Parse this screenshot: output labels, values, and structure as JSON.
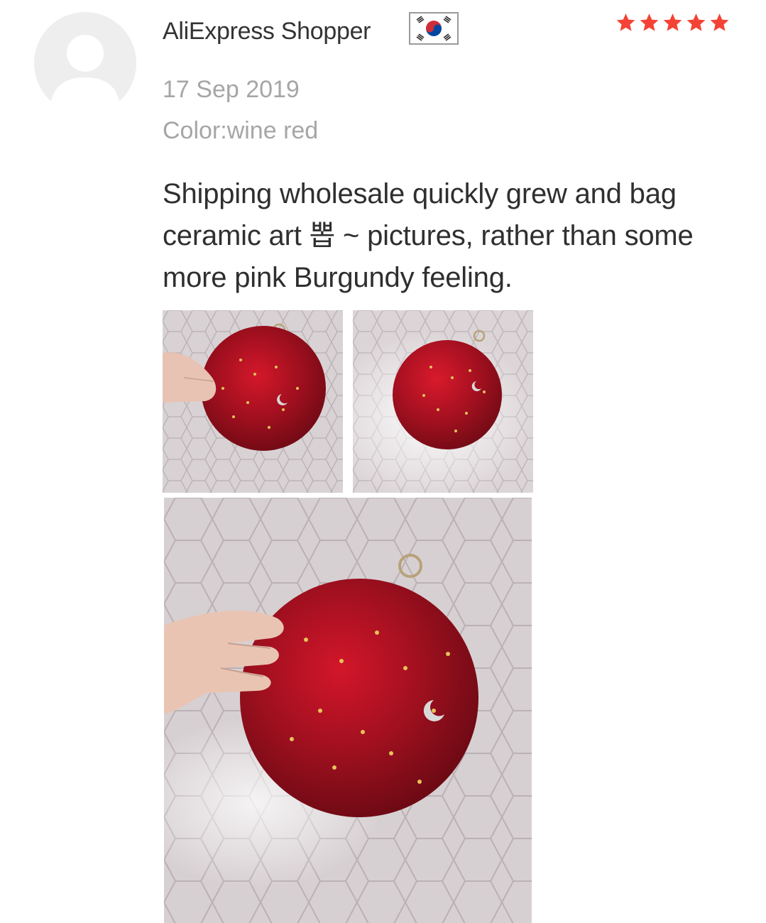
{
  "review": {
    "reviewer_name": "AliExpress Shopper",
    "country_flag_icon": "south-korea-flag-icon",
    "rating": 5,
    "rating_max": 5,
    "star_color": "#f44336",
    "date": "17 Sep 2019",
    "sku_attribute": "Color:wine red",
    "text": "Shipping wholesale quickly grew and bag ceramic art 뽑 ~ pictures, rather than some more pink Burgundy feeling.",
    "photo_count": 3
  }
}
